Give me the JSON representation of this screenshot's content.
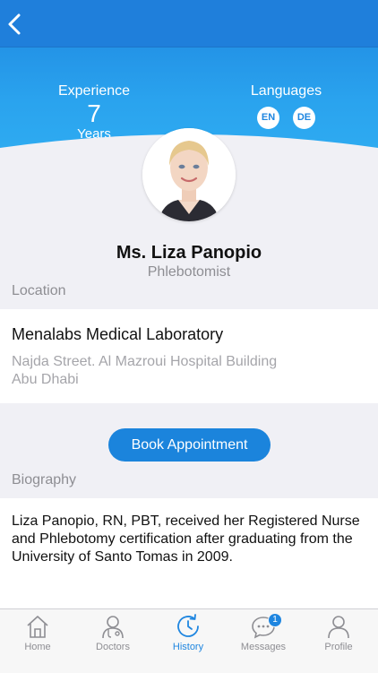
{
  "header": {
    "experience_label": "Experience",
    "experience_value": "7",
    "experience_unit": "Years",
    "languages_label": "Languages",
    "languages": [
      "EN",
      "DE"
    ]
  },
  "doctor": {
    "name": "Ms. Liza Panopio",
    "role": "Phlebotomist"
  },
  "location": {
    "label": "Location",
    "name": "Menalabs Medical Laboratory",
    "address_line1": "Najda Street. Al Mazroui Hospital Building",
    "address_line2": "Abu Dhabi"
  },
  "actions": {
    "book_label": "Book Appointment"
  },
  "biography": {
    "label": "Biography",
    "text": "Liza Panopio, RN, PBT, received her Registered Nurse and Phlebotomy certification after graduating from the University of Santo Tomas in 2009."
  },
  "tabbar": {
    "tabs": [
      {
        "label": "Home",
        "icon": "home-icon"
      },
      {
        "label": "Doctors",
        "icon": "doctor-icon"
      },
      {
        "label": "History",
        "icon": "history-icon"
      },
      {
        "label": "Messages",
        "icon": "chat-icon",
        "badge": "1"
      },
      {
        "label": "Profile",
        "icon": "person-icon"
      }
    ],
    "active": "History"
  },
  "colors": {
    "accent": "#1f86e0",
    "header_top": "#1f7fdb",
    "muted_text": "#8e8e93"
  }
}
